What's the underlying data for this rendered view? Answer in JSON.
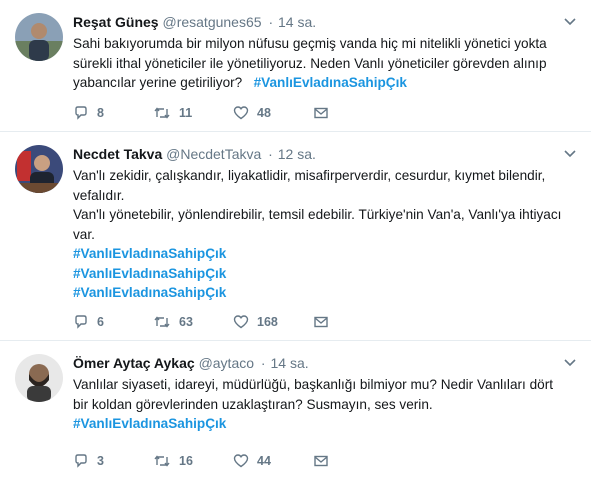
{
  "tweets": [
    {
      "name": "Reşat Güneş",
      "handle": "@resatgunes65",
      "dot": "·",
      "time": "14 sa.",
      "lines": [
        "Sahi bakıyorumda bir milyon nüfusu geçmiş vanda hiç mi nitelikli yönetici yokta",
        "sürekli ithal yöneticiler ile yönetiliyoruz. Neden Vanlı yöneticiler görevden alınıp",
        "yabancılar yerine getiriliyor?"
      ],
      "hashtag": "#VanlıEvladınaSahipÇık",
      "replies": "8",
      "retweets": "11",
      "likes": "48"
    },
    {
      "name": "Necdet Takva",
      "handle": "@NecdetTakva",
      "dot": "·",
      "time": "12 sa.",
      "lines": [
        "Van'lı zekidir, çalışkandır, liyakatlidir, misafirperverdir, cesurdur, kıymet bilendir,",
        "vefalıdır.",
        "Van'lı yönetebilir, yönlendirebilir, temsil edebilir. Türkiye'nin Van'a, Vanlı'ya ihtiyacı",
        "var."
      ],
      "hashtags": [
        "#VanlıEvladınaSahipÇık",
        "#VanlıEvladınaSahipÇık",
        "#VanlıEvladınaSahipÇık"
      ],
      "replies": "6",
      "retweets": "63",
      "likes": "168"
    },
    {
      "name": "Ömer Aytaç Aykaç",
      "handle": "@aytaco",
      "dot": "·",
      "time": "14 sa.",
      "lines": [
        "Vanlılar siyaseti, idareyi, müdürlüğü, başkanlığı bilmiyor mu? Nedir Vanlıları dört",
        "bir koldan görevlerinden uzaklaştıran? Susmayın, ses verin."
      ],
      "hashtag": "#VanlıEvladınaSahipÇık",
      "replies": "3",
      "retweets": "16",
      "likes": "44"
    }
  ],
  "colors": {
    "hashtag": "#1b95e0",
    "meta": "#657786",
    "divider": "#e6ecf0"
  },
  "icons": [
    "reply-icon",
    "retweet-icon",
    "like-icon",
    "direct-message-icon",
    "chevron-down-icon"
  ]
}
